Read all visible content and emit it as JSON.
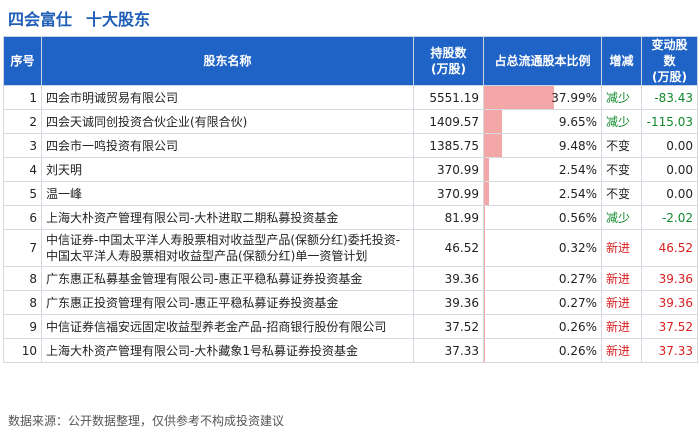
{
  "header": {
    "company": "四会富仕",
    "subtitle": "十大股东"
  },
  "columns": {
    "index": "序号",
    "name": "股东名称",
    "shares_line1": "持股数",
    "shares_line2": "(万股)",
    "ratio": "占总流通股本比例",
    "change": "增减",
    "delta_line1": "变动股数",
    "delta_line2": "(万股)"
  },
  "rows": [
    {
      "index": "1",
      "name": "四会市明诚贸易有限公司",
      "shares": "5551.19",
      "ratio_pct": 37.99,
      "ratio": "37.99%",
      "change": "减少",
      "change_type": "down",
      "delta": "-83.43",
      "delta_type": "neg"
    },
    {
      "index": "2",
      "name": "四会天诚同创投资合伙企业(有限合伙)",
      "shares": "1409.57",
      "ratio_pct": 9.65,
      "ratio": "9.65%",
      "change": "减少",
      "change_type": "down",
      "delta": "-115.03",
      "delta_type": "neg"
    },
    {
      "index": "3",
      "name": "四会市一鸣投资有限公司",
      "shares": "1385.75",
      "ratio_pct": 9.48,
      "ratio": "9.48%",
      "change": "不变",
      "change_type": "same",
      "delta": "0.00",
      "delta_type": "zero"
    },
    {
      "index": "4",
      "name": "刘天明",
      "shares": "370.99",
      "ratio_pct": 2.54,
      "ratio": "2.54%",
      "change": "不变",
      "change_type": "same",
      "delta": "0.00",
      "delta_type": "zero"
    },
    {
      "index": "5",
      "name": "温一峰",
      "shares": "370.99",
      "ratio_pct": 2.54,
      "ratio": "2.54%",
      "change": "不变",
      "change_type": "same",
      "delta": "0.00",
      "delta_type": "zero"
    },
    {
      "index": "6",
      "name": "上海大朴资产管理有限公司-大朴进取二期私募投资基金",
      "shares": "81.99",
      "ratio_pct": 0.56,
      "ratio": "0.56%",
      "change": "减少",
      "change_type": "down",
      "delta": "-2.02",
      "delta_type": "neg"
    },
    {
      "index": "7",
      "name": "中信证券-中国太平洋人寿股票相对收益型产品(保额分红)委托投资-中国太平洋人寿股票相对收益型产品(保额分红)单一资管计划",
      "shares": "46.52",
      "ratio_pct": 0.32,
      "ratio": "0.32%",
      "change": "新进",
      "change_type": "new",
      "delta": "46.52",
      "delta_type": "pos",
      "tall": true
    },
    {
      "index": "8",
      "name": "广东惠正私募基金管理有限公司-惠正平稳私募证券投资基金",
      "shares": "39.36",
      "ratio_pct": 0.27,
      "ratio": "0.27%",
      "change": "新进",
      "change_type": "new",
      "delta": "39.36",
      "delta_type": "pos"
    },
    {
      "index": "8",
      "name": "广东惠正投资管理有限公司-惠正平稳私募证券投资基金",
      "shares": "39.36",
      "ratio_pct": 0.27,
      "ratio": "0.27%",
      "change": "新进",
      "change_type": "new",
      "delta": "39.36",
      "delta_type": "pos"
    },
    {
      "index": "9",
      "name": "中信证券信福安远固定收益型养老金产品-招商银行股份有限公司",
      "shares": "37.52",
      "ratio_pct": 0.26,
      "ratio": "0.26%",
      "change": "新进",
      "change_type": "new",
      "delta": "37.52",
      "delta_type": "pos"
    },
    {
      "index": "10",
      "name": "上海大朴资产管理有限公司-大朴藏象1号私募证券投资基金",
      "shares": "37.33",
      "ratio_pct": 0.26,
      "ratio": "0.26%",
      "change": "新进",
      "change_type": "new",
      "delta": "37.33",
      "delta_type": "pos"
    }
  ],
  "ratio_scale_max": 37.99,
  "colors": {
    "header_bg": "#1f63c6",
    "bar": "#f4a7a7",
    "down": "#0f8a2c",
    "new": "#d91f1f",
    "title": "#1f5fb8"
  },
  "footer": "数据来源：公开数据整理，仅供参考不构成投资建议"
}
